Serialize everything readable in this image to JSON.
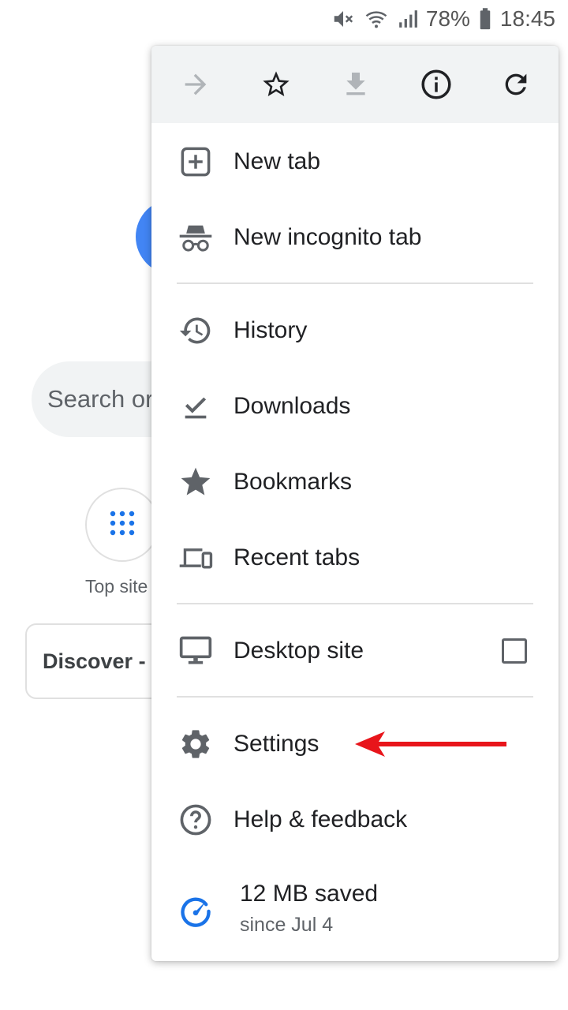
{
  "status_bar": {
    "battery": "78%",
    "time": "18:45",
    "icons": [
      "mute-icon",
      "wifi-icon",
      "signal-icon",
      "battery-icon"
    ]
  },
  "background_page": {
    "search_placeholder": "Search or",
    "top_sites_label": "Top site",
    "discover_label": "Discover -"
  },
  "menu": {
    "toolbar": [
      "forward-icon",
      "bookmark-star-icon",
      "download-icon",
      "page-info-icon",
      "refresh-icon"
    ],
    "items": [
      {
        "label": "New tab",
        "icon": "new-tab-icon"
      },
      {
        "label": "New incognito tab",
        "icon": "incognito-icon"
      },
      {
        "label": "History",
        "icon": "history-icon"
      },
      {
        "label": "Downloads",
        "icon": "downloads-icon"
      },
      {
        "label": "Bookmarks",
        "icon": "bookmarks-icon"
      },
      {
        "label": "Recent tabs",
        "icon": "recent-tabs-icon"
      },
      {
        "label": "Desktop site",
        "icon": "desktop-icon",
        "checked": false
      },
      {
        "label": "Settings",
        "icon": "settings-icon"
      },
      {
        "label": "Help & feedback",
        "icon": "help-icon"
      }
    ],
    "data_saver": {
      "title": "12 MB saved",
      "subtitle": "since Jul 4"
    }
  },
  "colors": {
    "icon_gray": "#5f6368",
    "toolbar_bg": "#f1f3f4",
    "accent_blue": "#1a73e8",
    "arrow_red": "#e8151b"
  }
}
